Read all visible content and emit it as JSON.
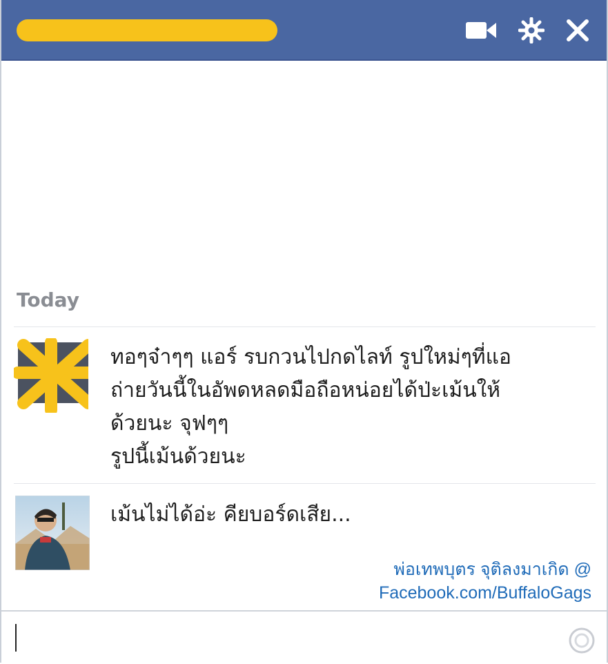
{
  "header": {
    "contact_name_redacted": true,
    "icons": [
      "video-call-icon",
      "gear-icon",
      "close-icon"
    ]
  },
  "conversation": {
    "date_label": "Today",
    "messages": [
      {
        "sender_avatar": "redacted-avatar",
        "lines": [
          "ทอๆจ๋าๆๆ แอร์ รบกวนไปกดไลท์ รูปใหม่ๆที่แอ",
          "ถ่ายวันนี้ในอัพดหลดมือถือหน่อยได้ป่ะเม้นให้",
          "ด้วยนะ จุฟๆๆ",
          "รูปนี้เม้นด้วยนะ"
        ]
      },
      {
        "sender_avatar": "user-photo",
        "lines": [
          "เม้นไม่ได้อ่ะ คียบอร์ดเสีย..."
        ]
      }
    ]
  },
  "watermark": {
    "line1": "พ่อเทพบุตร จุติลงมาเกิด @",
    "line2": "Facebook.com/BuffaloGags"
  },
  "colors": {
    "titlebar": "#4a67a2",
    "redaction": "#f7c21b",
    "watermark": "#1f6bb8"
  }
}
